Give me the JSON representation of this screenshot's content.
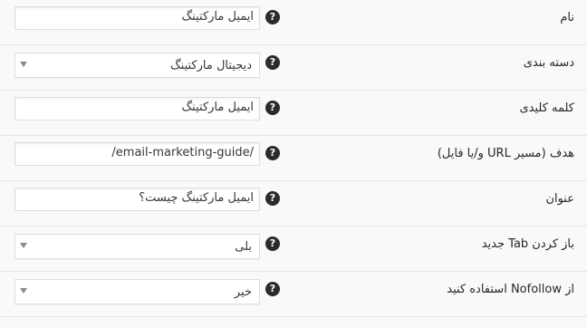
{
  "fields": [
    {
      "label": "نام",
      "type": "text",
      "value": "ایمیل مارکتینگ",
      "help": "?"
    },
    {
      "label": "دسته بندی",
      "type": "select",
      "value": "دیجیتال مارکتینگ",
      "help": "?"
    },
    {
      "label": "کلمه کلیدی",
      "type": "text",
      "value": "ایمیل مارکتینگ",
      "help": "?"
    },
    {
      "label": "هدف (مسیر URL و/یا فایل)",
      "type": "text",
      "value": "/email-marketing-guide/",
      "help": "?"
    },
    {
      "label": "عنوان",
      "type": "text",
      "value": "ایمیل مارکتینگ چیست؟",
      "help": "?"
    },
    {
      "label": "باز کردن Tab جدید",
      "type": "select",
      "value": "بلی",
      "help": "?"
    },
    {
      "label": "از Nofollow استفاده کنید",
      "type": "select",
      "value": "خیر",
      "help": "?"
    }
  ],
  "colors": {
    "background": "#f9f9f9",
    "divider": "#e5e5e5",
    "field_border": "#dddddd",
    "help_icon": "#2b2b2b"
  }
}
